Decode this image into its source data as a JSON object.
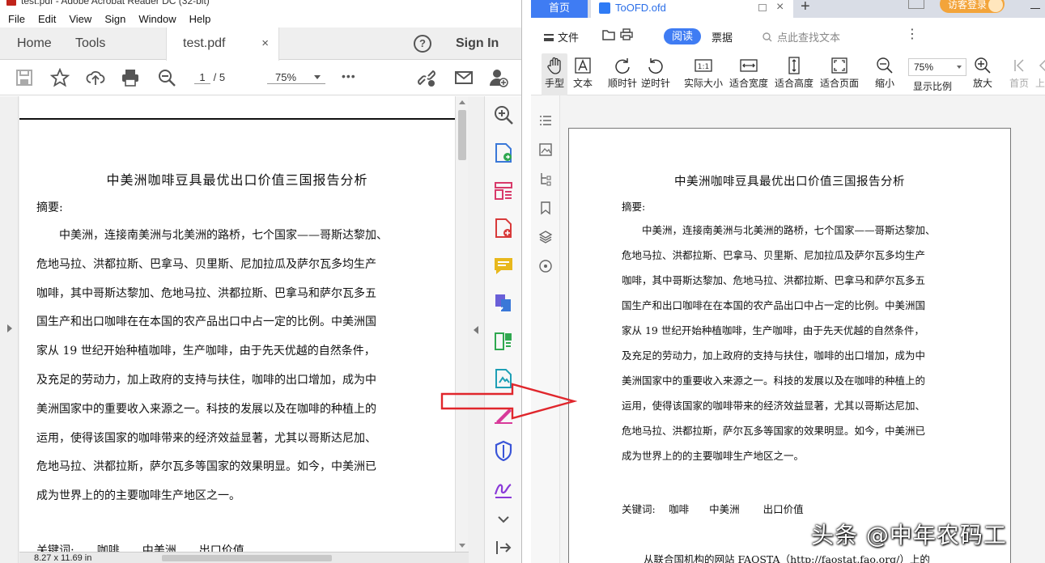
{
  "acrobat": {
    "window_title": "test.pdf - Adobe Acrobat Reader DC (32-bit)",
    "menu": [
      "File",
      "Edit",
      "View",
      "Sign",
      "Window",
      "Help"
    ],
    "tabs": {
      "home": "Home",
      "tools": "Tools",
      "doc": "test.pdf",
      "close": "×"
    },
    "help_label": "?",
    "signin": "Sign In",
    "page_current": "1",
    "page_total": "/ 5",
    "zoom": "75%",
    "more": "•••",
    "status_size": "8.27 x 11.69 in",
    "icons": [
      "save-icon",
      "bookmark-star-icon",
      "upload-icon",
      "print-icon",
      "zoom-out-icon",
      "link-icon",
      "mail-icon",
      "add-user-icon"
    ],
    "tools_pane_icons": [
      "zoom-icon",
      "export-pdf-icon",
      "organize-icon",
      "create-pdf-icon",
      "comment-icon",
      "combine-icon",
      "compress-icon",
      "scan-icon",
      "fill-sign-icon",
      "protect-icon",
      "sign-icon",
      "chevron-down-icon",
      "collapse-icon"
    ]
  },
  "document": {
    "title": "中美洲咖啡豆具最优出口价值三国报告分析",
    "abstract_label": "摘要:",
    "left_lines": [
      "　　中美洲，连接南美洲与北美洲的路桥，七个国家——哥斯达黎加、",
      "危地马拉、洪都拉斯、巴拿马、贝里斯、尼加拉瓜及萨尔瓦多均生产",
      "咖啡，其中哥斯达黎加、危地马拉、洪都拉斯、巴拿马和萨尔瓦多五",
      "国生产和出口咖啡在在本国的农产品出口中占一定的比例。中美洲国",
      "家从 19 世纪开始种植咖啡，生产咖啡，由于先天优越的自然条件，",
      "及充足的劳动力，加上政府的支持与扶住，咖啡的出口增加，成为中",
      "美洲国家中的重要收入来源之一。科技的发展以及在咖啡的种植上的",
      "运用，使得该国家的咖啡带来的经济效益显著，尤其以哥斯达尼加、",
      "危地马拉、洪都拉斯，萨尔瓦多等国家的效果明显。如今，中美洲已",
      "成为世界上的的主要咖啡生产地区之一。"
    ],
    "left_keywords": "关键词:　　咖啡　　中美洲　　出口价值",
    "right_lines": [
      "　　中美洲，连接南美洲与北美洲的路桥，七个国家——哥斯达黎加、",
      "危地马拉、洪都拉斯、巴拿马、贝里斯、尼加拉瓜及萨尔瓦多均生产",
      "咖啡，其中哥斯达黎加、危地马拉、洪都拉斯、巴拿马和萨尔瓦多五",
      "国生产和出口咖啡在在本国的农产品出口中占一定的比例。中美洲国",
      "家从 19 世纪开始种植咖啡，生产咖啡，由于先天优越的自然条件，",
      "及充足的劳动力，加上政府的支持与扶住，咖啡的出口增加，成为中",
      "美洲国家中的重要收入来源之一。科技的发展以及在咖啡的种植上的",
      "运用，使得该国家的咖啡带来的经济效益显著，尤其以哥斯达尼加、",
      "危地马拉、洪都拉斯，萨尔瓦多等国家的效果明显。如今，中美洲已",
      "成为世界上的的主要咖啡生产地区之一。"
    ],
    "right_keywords": "关键词:　 咖啡　　中美洲　　 出口价值",
    "right_last_line": "从联合国机构的网站 FAOSTA（http://faostat.fao.org/）上的"
  },
  "ofd": {
    "home_tab": "首页",
    "doc_tab": "ToOFD.ofd",
    "doc_tab_close": "×",
    "new_tab": "+",
    "login": "访客登录",
    "file_menu": "文件",
    "mode_read": "阅读",
    "mode_annotate": "票据",
    "search_placeholder": "点此查找文本",
    "more": "⋮",
    "zoom": "75%",
    "toolbar": [
      {
        "label": "手型",
        "icon": "hand-icon"
      },
      {
        "label": "文本",
        "icon": "text-select-icon"
      },
      {
        "label": "顺时针",
        "icon": "rotate-cw-icon"
      },
      {
        "label": "逆时针",
        "icon": "rotate-ccw-icon"
      },
      {
        "label": "实际大小",
        "icon": "actual-size-icon"
      },
      {
        "label": "适合宽度",
        "icon": "fit-width-icon"
      },
      {
        "label": "适合高度",
        "icon": "fit-height-icon"
      },
      {
        "label": "适合页面",
        "icon": "fit-page-icon"
      },
      {
        "label": "缩小",
        "icon": "zoom-out-icon"
      },
      {
        "label": "显示比例",
        "icon": "zoom-ratio-icon"
      },
      {
        "label": "放大",
        "icon": "zoom-in-icon"
      },
      {
        "label": "首页",
        "icon": "first-page-icon"
      },
      {
        "label": "上",
        "icon": "prev-page-icon"
      }
    ],
    "sidebar_icons": [
      "outline-icon",
      "thumbnail-icon",
      "tree-icon",
      "bookmark-icon",
      "layers-icon",
      "attachment-icon"
    ]
  },
  "overlay": {
    "watermark": "头条 @中年农码工",
    "arrow_color": "#e0262c"
  }
}
